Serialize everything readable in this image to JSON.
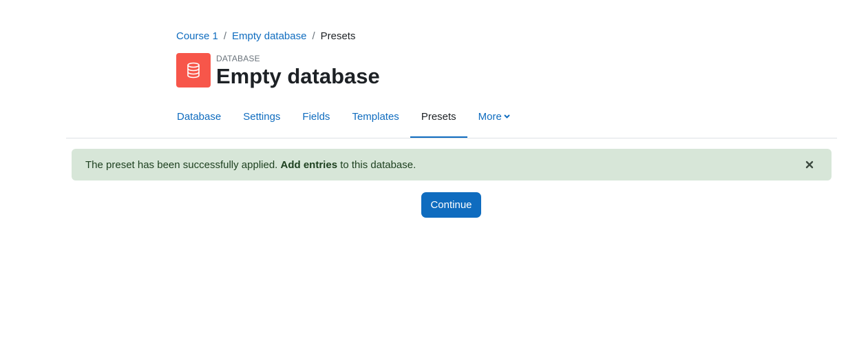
{
  "breadcrumb": {
    "items": [
      {
        "label": "Course 1"
      },
      {
        "label": "Empty database"
      }
    ],
    "separator": "/",
    "current": "Presets"
  },
  "header": {
    "icon": "database-icon",
    "icon_bg": "#f7564a",
    "activity_type": "DATABASE",
    "title": "Empty database"
  },
  "tabs": [
    {
      "label": "Database",
      "active": false
    },
    {
      "label": "Settings",
      "active": false
    },
    {
      "label": "Fields",
      "active": false
    },
    {
      "label": "Templates",
      "active": false
    },
    {
      "label": "Presets",
      "active": true
    },
    {
      "label": "More",
      "active": false,
      "icon": "chevron-down-icon"
    }
  ],
  "alert": {
    "text_before": "The preset has been successfully applied.",
    "link_text": "Add entries",
    "text_after": "to this database.",
    "close_icon": "close-icon",
    "bg_color": "#d7e6d8"
  },
  "actions": {
    "continue_label": "Continue"
  },
  "colors": {
    "accent": "#0f6cbf",
    "text": "#1d2125"
  }
}
